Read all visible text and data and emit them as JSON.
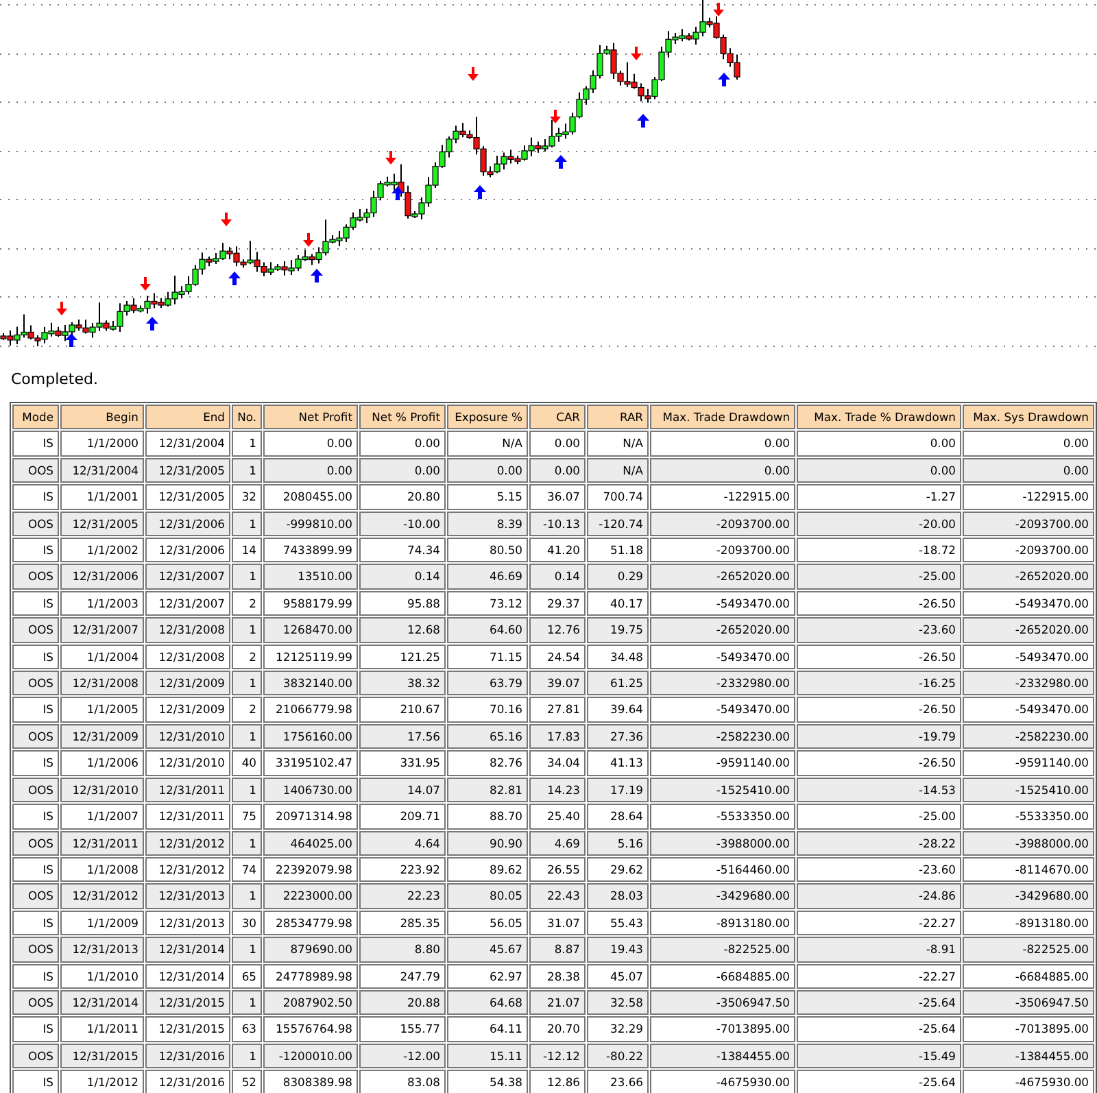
{
  "status": "Completed.",
  "table": {
    "columns": [
      "Mode",
      "Begin",
      "End",
      "No.",
      "Net Profit",
      "Net % Profit",
      "Exposure %",
      "CAR",
      "RAR",
      "Max. Trade Drawdown",
      "Max. Trade % Drawdown",
      "Max. Sys Drawdown"
    ],
    "rows": [
      [
        "IS",
        "1/1/2000",
        "12/31/2004",
        "1",
        "0.00",
        "0.00",
        "N/A",
        "0.00",
        "N/A",
        "0.00",
        "0.00",
        "0.00"
      ],
      [
        "OOS",
        "12/31/2004",
        "12/31/2005",
        "1",
        "0.00",
        "0.00",
        "0.00",
        "0.00",
        "N/A",
        "0.00",
        "0.00",
        "0.00"
      ],
      [
        "IS",
        "1/1/2001",
        "12/31/2005",
        "32",
        "2080455.00",
        "20.80",
        "5.15",
        "36.07",
        "700.74",
        "-122915.00",
        "-1.27",
        "-122915.00"
      ],
      [
        "OOS",
        "12/31/2005",
        "12/31/2006",
        "1",
        "-999810.00",
        "-10.00",
        "8.39",
        "-10.13",
        "-120.74",
        "-2093700.00",
        "-20.00",
        "-2093700.00"
      ],
      [
        "IS",
        "1/1/2002",
        "12/31/2006",
        "14",
        "7433899.99",
        "74.34",
        "80.50",
        "41.20",
        "51.18",
        "-2093700.00",
        "-18.72",
        "-2093700.00"
      ],
      [
        "OOS",
        "12/31/2006",
        "12/31/2007",
        "1",
        "13510.00",
        "0.14",
        "46.69",
        "0.14",
        "0.29",
        "-2652020.00",
        "-25.00",
        "-2652020.00"
      ],
      [
        "IS",
        "1/1/2003",
        "12/31/2007",
        "2",
        "9588179.99",
        "95.88",
        "73.12",
        "29.37",
        "40.17",
        "-5493470.00",
        "-26.50",
        "-5493470.00"
      ],
      [
        "OOS",
        "12/31/2007",
        "12/31/2008",
        "1",
        "1268470.00",
        "12.68",
        "64.60",
        "12.76",
        "19.75",
        "-2652020.00",
        "-23.60",
        "-2652020.00"
      ],
      [
        "IS",
        "1/1/2004",
        "12/31/2008",
        "2",
        "12125119.99",
        "121.25",
        "71.15",
        "24.54",
        "34.48",
        "-5493470.00",
        "-26.50",
        "-5493470.00"
      ],
      [
        "OOS",
        "12/31/2008",
        "12/31/2009",
        "1",
        "3832140.00",
        "38.32",
        "63.79",
        "39.07",
        "61.25",
        "-2332980.00",
        "-16.25",
        "-2332980.00"
      ],
      [
        "IS",
        "1/1/2005",
        "12/31/2009",
        "2",
        "21066779.98",
        "210.67",
        "70.16",
        "27.81",
        "39.64",
        "-5493470.00",
        "-26.50",
        "-5493470.00"
      ],
      [
        "OOS",
        "12/31/2009",
        "12/31/2010",
        "1",
        "1756160.00",
        "17.56",
        "65.16",
        "17.83",
        "27.36",
        "-2582230.00",
        "-19.79",
        "-2582230.00"
      ],
      [
        "IS",
        "1/1/2006",
        "12/31/2010",
        "40",
        "33195102.47",
        "331.95",
        "82.76",
        "34.04",
        "41.13",
        "-9591140.00",
        "-26.50",
        "-9591140.00"
      ],
      [
        "OOS",
        "12/31/2010",
        "12/31/2011",
        "1",
        "1406730.00",
        "14.07",
        "82.81",
        "14.23",
        "17.19",
        "-1525410.00",
        "-14.53",
        "-1525410.00"
      ],
      [
        "IS",
        "1/1/2007",
        "12/31/2011",
        "75",
        "20971314.98",
        "209.71",
        "88.70",
        "25.40",
        "28.64",
        "-5533350.00",
        "-25.00",
        "-5533350.00"
      ],
      [
        "OOS",
        "12/31/2011",
        "12/31/2012",
        "1",
        "464025.00",
        "4.64",
        "90.90",
        "4.69",
        "5.16",
        "-3988000.00",
        "-28.22",
        "-3988000.00"
      ],
      [
        "IS",
        "1/1/2008",
        "12/31/2012",
        "74",
        "22392079.98",
        "223.92",
        "89.62",
        "26.55",
        "29.62",
        "-5164460.00",
        "-23.60",
        "-8114670.00"
      ],
      [
        "OOS",
        "12/31/2012",
        "12/31/2013",
        "1",
        "2223000.00",
        "22.23",
        "80.05",
        "22.43",
        "28.03",
        "-3429680.00",
        "-24.86",
        "-3429680.00"
      ],
      [
        "IS",
        "1/1/2009",
        "12/31/2013",
        "30",
        "28534779.98",
        "285.35",
        "56.05",
        "31.07",
        "55.43",
        "-8913180.00",
        "-22.27",
        "-8913180.00"
      ],
      [
        "OOS",
        "12/31/2013",
        "12/31/2014",
        "1",
        "879690.00",
        "8.80",
        "45.67",
        "8.87",
        "19.43",
        "-822525.00",
        "-8.91",
        "-822525.00"
      ],
      [
        "IS",
        "1/1/2010",
        "12/31/2014",
        "65",
        "24778989.98",
        "247.79",
        "62.97",
        "28.38",
        "45.07",
        "-6684885.00",
        "-22.27",
        "-6684885.00"
      ],
      [
        "OOS",
        "12/31/2014",
        "12/31/2015",
        "1",
        "2087902.50",
        "20.88",
        "64.68",
        "21.07",
        "32.58",
        "-3506947.50",
        "-25.64",
        "-3506947.50"
      ],
      [
        "IS",
        "1/1/2011",
        "12/31/2015",
        "63",
        "15576764.98",
        "155.77",
        "64.11",
        "20.70",
        "32.29",
        "-7013895.00",
        "-25.64",
        "-7013895.00"
      ],
      [
        "OOS",
        "12/31/2015",
        "12/31/2016",
        "1",
        "-1200010.00",
        "-12.00",
        "15.11",
        "-12.12",
        "-80.22",
        "-1384455.00",
        "-15.49",
        "-1384455.00"
      ],
      [
        "IS",
        "1/1/2012",
        "12/31/2016",
        "52",
        "8308389.98",
        "83.08",
        "54.38",
        "12.86",
        "23.66",
        "-4675930.00",
        "-25.64",
        "-4675930.00"
      ]
    ]
  }
}
